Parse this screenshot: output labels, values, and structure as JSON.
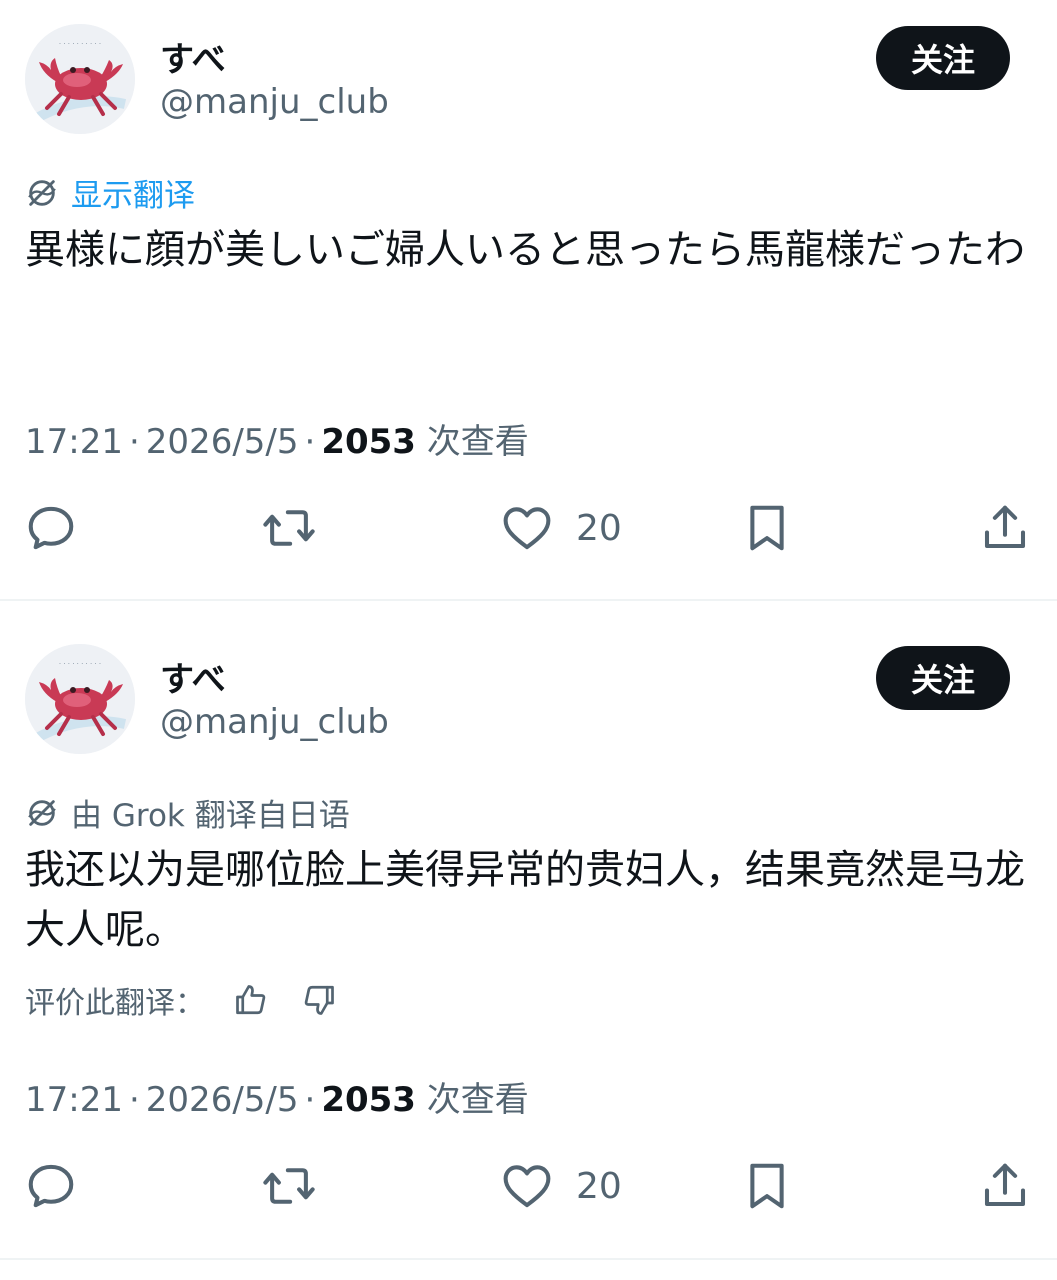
{
  "posts": [
    {
      "author": {
        "display_name": "すべ",
        "handle": "@manju_club"
      },
      "follow_label": "关注",
      "translate_link": "显示翻译",
      "body": "異様に顔が美しいご婦人いると思ったら馬龍様だったわ",
      "time": "17:21",
      "date": "2026/5/5",
      "views": "2053",
      "views_label": "次查看",
      "likes": "20"
    },
    {
      "author": {
        "display_name": "すべ",
        "handle": "@manju_club"
      },
      "follow_label": "关注",
      "translate_note": "由 Grok 翻译自日语",
      "body": "我还以为是哪位脸上美得异常的贵妇人，结果竟然是马龙大人呢。",
      "rate_label": "评价此翻译：",
      "time": "17:21",
      "date": "2026/5/5",
      "views": "2053",
      "views_label": "次查看",
      "likes": "20"
    }
  ],
  "separator": "·",
  "icons": {
    "avatar": "crab-avatar-icon",
    "translate": "translate-icon",
    "reply": "reply-icon",
    "repost": "repost-icon",
    "like": "heart-icon",
    "bookmark": "bookmark-icon",
    "share": "share-icon",
    "thumbs_up": "thumbs-up-icon",
    "thumbs_down": "thumbs-down-icon"
  },
  "colors": {
    "text": "#0f1419",
    "secondary": "#536471",
    "link": "#1d9bf0",
    "button": "#0f1419",
    "divider": "#eff3f4"
  }
}
